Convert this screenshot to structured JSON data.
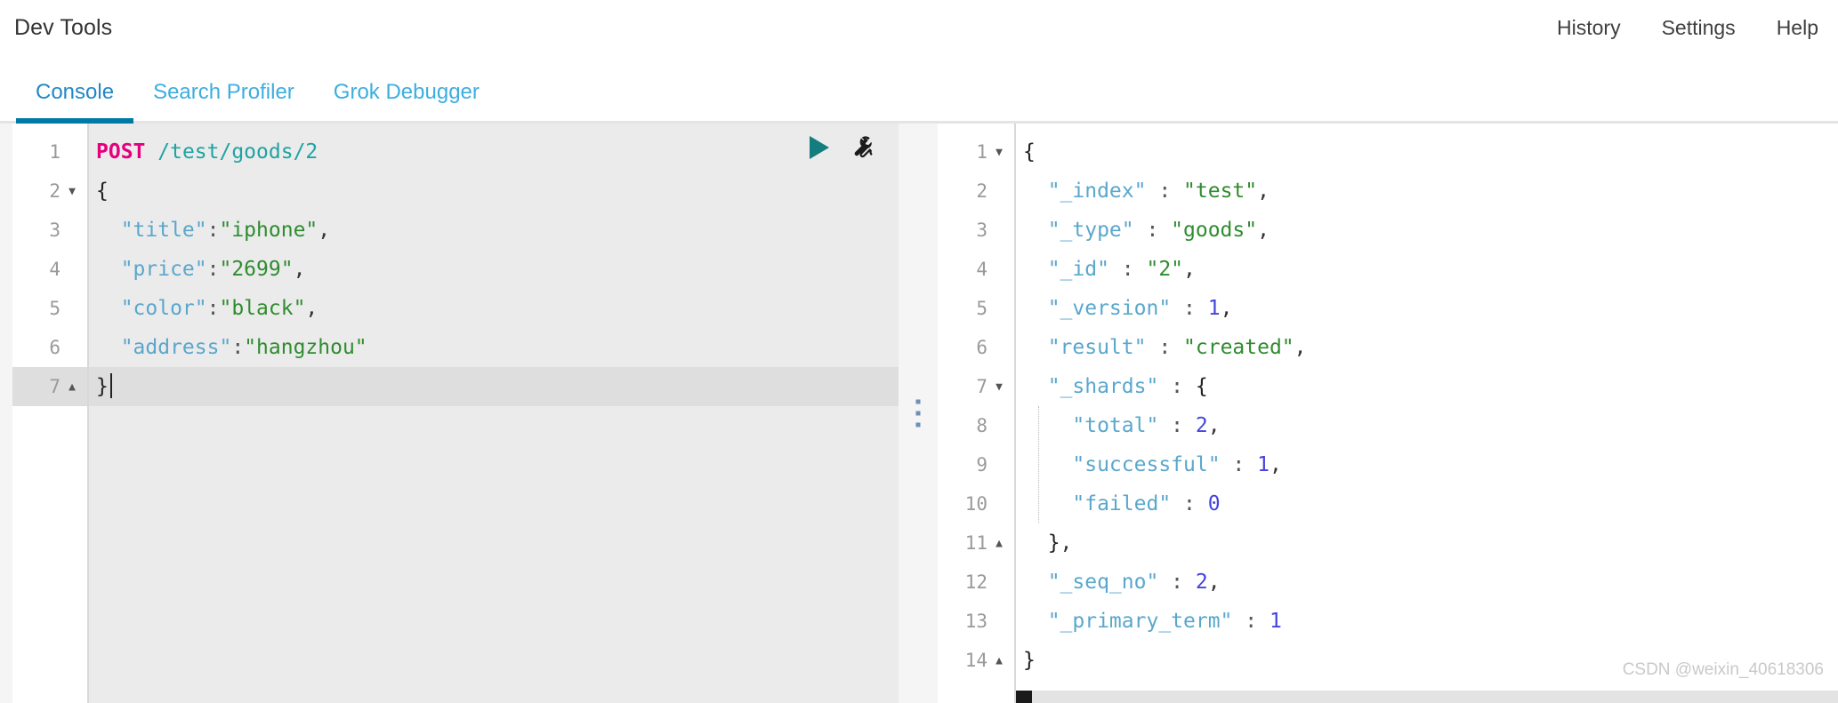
{
  "header": {
    "title": "Dev Tools",
    "links": [
      {
        "label": "History",
        "name": "history"
      },
      {
        "label": "Settings",
        "name": "settings"
      },
      {
        "label": "Help",
        "name": "help"
      }
    ]
  },
  "tabs": [
    {
      "label": "Console",
      "active": true
    },
    {
      "label": "Search Profiler",
      "active": false
    },
    {
      "label": "Grok Debugger",
      "active": false
    }
  ],
  "colors": {
    "accent": "#0079a5",
    "tab_link": "#3caee0",
    "method": "#e5007d",
    "url": "#1fa3a3",
    "key": "#5aa7cc",
    "string": "#2f8c2f",
    "number": "#4444dd",
    "play": "#147d7d",
    "editor_bg": "#ebebeb",
    "active_line": "#dedede"
  },
  "request_editor": {
    "name": "request-editor",
    "active_line": 7,
    "icons": [
      {
        "name": "play-icon",
        "title": "Click to send request"
      },
      {
        "name": "wrench-icon",
        "title": "Open documentation"
      }
    ],
    "lines": [
      {
        "number": "1",
        "fold": "",
        "tokens": [
          {
            "cls": "t-method",
            "text": "POST"
          },
          {
            "cls": "t-punc",
            "text": " "
          },
          {
            "cls": "t-url",
            "text": "/test/goods/2"
          }
        ]
      },
      {
        "number": "2",
        "fold": "down",
        "tokens": [
          {
            "cls": "t-brace",
            "text": "{"
          }
        ]
      },
      {
        "number": "3",
        "fold": "",
        "tokens": [
          {
            "cls": "t-key",
            "text": "  \"title\""
          },
          {
            "cls": "t-colon",
            "text": ":"
          },
          {
            "cls": "t-str",
            "text": "\"iphone\""
          },
          {
            "cls": "t-punc",
            "text": ","
          }
        ]
      },
      {
        "number": "4",
        "fold": "",
        "tokens": [
          {
            "cls": "t-key",
            "text": "  \"price\""
          },
          {
            "cls": "t-colon",
            "text": ":"
          },
          {
            "cls": "t-str",
            "text": "\"2699\""
          },
          {
            "cls": "t-punc",
            "text": ","
          }
        ]
      },
      {
        "number": "5",
        "fold": "",
        "tokens": [
          {
            "cls": "t-key",
            "text": "  \"color\""
          },
          {
            "cls": "t-colon",
            "text": ":"
          },
          {
            "cls": "t-str",
            "text": "\"black\""
          },
          {
            "cls": "t-punc",
            "text": ","
          }
        ]
      },
      {
        "number": "6",
        "fold": "",
        "tokens": [
          {
            "cls": "t-key",
            "text": "  \"address\""
          },
          {
            "cls": "t-colon",
            "text": ":"
          },
          {
            "cls": "t-str",
            "text": "\"hangzhou\""
          }
        ]
      },
      {
        "number": "7",
        "fold": "up",
        "cursor": true,
        "tokens": [
          {
            "cls": "t-brace",
            "text": "}"
          }
        ]
      }
    ]
  },
  "response_editor": {
    "name": "response-editor",
    "lines": [
      {
        "number": "1",
        "fold": "down",
        "tokens": [
          {
            "cls": "t-brace",
            "text": "{"
          }
        ]
      },
      {
        "number": "2",
        "fold": "",
        "tokens": [
          {
            "cls": "t-key",
            "text": "  \"_index\""
          },
          {
            "cls": "t-colon",
            "text": " : "
          },
          {
            "cls": "t-str",
            "text": "\"test\""
          },
          {
            "cls": "t-punc",
            "text": ","
          }
        ]
      },
      {
        "number": "3",
        "fold": "",
        "tokens": [
          {
            "cls": "t-key",
            "text": "  \"_type\""
          },
          {
            "cls": "t-colon",
            "text": " : "
          },
          {
            "cls": "t-str",
            "text": "\"goods\""
          },
          {
            "cls": "t-punc",
            "text": ","
          }
        ]
      },
      {
        "number": "4",
        "fold": "",
        "tokens": [
          {
            "cls": "t-key",
            "text": "  \"_id\""
          },
          {
            "cls": "t-colon",
            "text": " : "
          },
          {
            "cls": "t-str",
            "text": "\"2\""
          },
          {
            "cls": "t-punc",
            "text": ","
          }
        ]
      },
      {
        "number": "5",
        "fold": "",
        "tokens": [
          {
            "cls": "t-key",
            "text": "  \"_version\""
          },
          {
            "cls": "t-colon",
            "text": " : "
          },
          {
            "cls": "t-num",
            "text": "1"
          },
          {
            "cls": "t-punc",
            "text": ","
          }
        ]
      },
      {
        "number": "6",
        "fold": "",
        "tokens": [
          {
            "cls": "t-key",
            "text": "  \"result\""
          },
          {
            "cls": "t-colon",
            "text": " : "
          },
          {
            "cls": "t-str",
            "text": "\"created\""
          },
          {
            "cls": "t-punc",
            "text": ","
          }
        ]
      },
      {
        "number": "7",
        "fold": "down",
        "tokens": [
          {
            "cls": "t-key",
            "text": "  \"_shards\""
          },
          {
            "cls": "t-colon",
            "text": " : "
          },
          {
            "cls": "t-brace",
            "text": "{"
          }
        ]
      },
      {
        "number": "8",
        "fold": "",
        "tokens": [
          {
            "cls": "t-key",
            "text": "    \"total\""
          },
          {
            "cls": "t-colon",
            "text": " : "
          },
          {
            "cls": "t-num",
            "text": "2"
          },
          {
            "cls": "t-punc",
            "text": ","
          }
        ]
      },
      {
        "number": "9",
        "fold": "",
        "tokens": [
          {
            "cls": "t-key",
            "text": "    \"successful\""
          },
          {
            "cls": "t-colon",
            "text": " : "
          },
          {
            "cls": "t-num",
            "text": "1"
          },
          {
            "cls": "t-punc",
            "text": ","
          }
        ]
      },
      {
        "number": "10",
        "fold": "",
        "tokens": [
          {
            "cls": "t-key",
            "text": "    \"failed\""
          },
          {
            "cls": "t-colon",
            "text": " : "
          },
          {
            "cls": "t-num",
            "text": "0"
          }
        ]
      },
      {
        "number": "11",
        "fold": "up",
        "tokens": [
          {
            "cls": "t-brace",
            "text": "  }"
          },
          {
            "cls": "t-punc",
            "text": ","
          }
        ]
      },
      {
        "number": "12",
        "fold": "",
        "tokens": [
          {
            "cls": "t-key",
            "text": "  \"_seq_no\""
          },
          {
            "cls": "t-colon",
            "text": " : "
          },
          {
            "cls": "t-num",
            "text": "2"
          },
          {
            "cls": "t-punc",
            "text": ","
          }
        ]
      },
      {
        "number": "13",
        "fold": "",
        "tokens": [
          {
            "cls": "t-key",
            "text": "  \"_primary_term\""
          },
          {
            "cls": "t-colon",
            "text": " : "
          },
          {
            "cls": "t-num",
            "text": "1"
          }
        ]
      },
      {
        "number": "14",
        "fold": "up",
        "tokens": [
          {
            "cls": "t-brace",
            "text": "}"
          }
        ]
      }
    ]
  },
  "splitter": {
    "name": "pane-splitter"
  },
  "watermark": {
    "text": "CSDN @weixin_40618306"
  }
}
